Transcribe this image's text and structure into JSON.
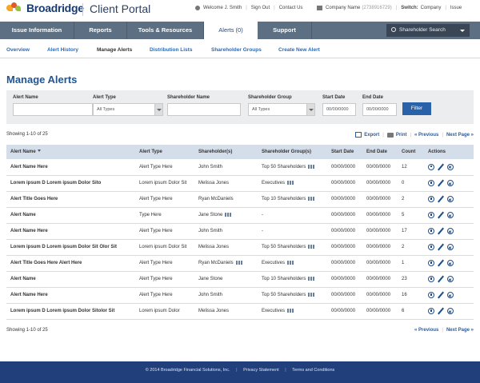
{
  "header": {
    "logo_text": "Broadridge",
    "portal_title": "Client Portal",
    "welcome": "Welcome  J. Smith",
    "sign_out": "Sign Out",
    "contact_us": "Contact Us",
    "company_name": "Company Name",
    "company_id": "(2738916729)",
    "switch_label": "Switch:",
    "switch_company": "Company",
    "switch_issue": "Issue"
  },
  "main_nav": {
    "tabs": [
      "Issue Information",
      "Reports",
      "Tools & Resources",
      "Alerts (0)",
      "Support"
    ],
    "active": "Alerts (0)",
    "search_label": "Shareholder Search"
  },
  "sub_nav": {
    "items": [
      "Overview",
      "Alert History",
      "Manage Alerts",
      "Distribution Lists",
      "Shareholder Groups",
      "Create New Alert"
    ],
    "active": "Manage Alerts"
  },
  "page": {
    "title": "Manage Alerts"
  },
  "filters": {
    "alert_name_label": "Alert Name",
    "alert_type_label": "Alert Type",
    "alert_type_value": "All Types",
    "shareholder_name_label": "Shareholder Name",
    "shareholder_group_label": "Shareholder Group",
    "shareholder_group_value": "All Types",
    "start_date_label": "Start Date",
    "start_date_value": "00/00/0000",
    "end_date_label": "End Date",
    "end_date_value": "00/00/0000",
    "filter_button": "Filter"
  },
  "results": {
    "showing": "Showing 1-10 of 25",
    "export": "Export",
    "print": "Print",
    "previous": "« Previous",
    "next": "Next Page »"
  },
  "table": {
    "columns": [
      "Alert Name",
      "Alert Type",
      "Shareholder(s)",
      "Shareholder Group(s)",
      "Start Date",
      "End Date",
      "Count",
      "Actions"
    ],
    "rows": [
      {
        "name": "Alert Name Here",
        "type": "Alert Type Here",
        "shareholder": "John Smith",
        "sh_icon": false,
        "group": "Top 50 Shareholders",
        "group_icon": true,
        "start": "00/00/0000",
        "end": "00/00/0000",
        "count": "12"
      },
      {
        "name": "Lorem ipsum D Lorem ipsum Dolor Sito",
        "type": "Lorem ipsum Dolor Sit",
        "shareholder": "Melissa Jones",
        "sh_icon": false,
        "group": "Executives",
        "group_icon": true,
        "start": "00/00/0000",
        "end": "00/00/0000",
        "count": "0"
      },
      {
        "name": "Alert Title Goes Here",
        "type": "Alert Type Here",
        "shareholder": "Ryan McDaniels",
        "sh_icon": false,
        "group": "Top 10 Shareholders",
        "group_icon": true,
        "start": "00/00/0000",
        "end": "00/00/0000",
        "count": "2"
      },
      {
        "name": "Alert Name",
        "type": "Type Here",
        "shareholder": "Jane Stone",
        "sh_icon": true,
        "group": "-",
        "group_icon": false,
        "start": "00/00/0000",
        "end": "00/00/0000",
        "count": "5"
      },
      {
        "name": "Alert Name Here",
        "type": "Alert Type Here",
        "shareholder": "John Smith",
        "sh_icon": false,
        "group": "-",
        "group_icon": false,
        "start": "00/00/0000",
        "end": "00/00/0000",
        "count": "17"
      },
      {
        "name": "Lorem ipsum D Lorem ipsum Dolor Sit Olor Sit",
        "type": "Lorem ipsum Dolor Sit",
        "shareholder": "Melissa Jones",
        "sh_icon": false,
        "group": "Top 50 Shareholders",
        "group_icon": true,
        "start": "00/00/0000",
        "end": "00/00/0000",
        "count": "2"
      },
      {
        "name": "Alert Title Goes Here Alert Here",
        "type": "Alert Type Here",
        "shareholder": "Ryan McDaniels",
        "sh_icon": true,
        "group": "Executives",
        "group_icon": true,
        "start": "00/00/0000",
        "end": "00/00/0000",
        "count": "1"
      },
      {
        "name": "Alert Name",
        "type": "Alert Type Here",
        "shareholder": "Jane Stone",
        "sh_icon": false,
        "group": "Top 10 Shareholders",
        "group_icon": true,
        "start": "00/00/0000",
        "end": "00/00/0000",
        "count": "23"
      },
      {
        "name": "Alert Name Here",
        "type": "Alert Type Here",
        "shareholder": "John Smith",
        "sh_icon": false,
        "group": "Top 50 Shareholders",
        "group_icon": true,
        "start": "00/00/0000",
        "end": "00/00/0000",
        "count": "16"
      },
      {
        "name": "Lorem ipsum D Lorem ipsum Dolor Sitolor Sit",
        "type": "Lorem ipsum Dolor",
        "shareholder": "Melissa Jones",
        "sh_icon": false,
        "group": "Executives",
        "group_icon": true,
        "start": "00/00/0000",
        "end": "00/00/0000",
        "count": "6"
      }
    ]
  },
  "footer": {
    "copyright": "© 2014 Broadridge Financial Solutions, Inc.",
    "privacy": "Privacy Statement",
    "terms": "Terms and Conditions"
  },
  "colors": {
    "nav_bg": "#5d6f82",
    "brand_blue": "#1f5594",
    "footer_bg": "#213f7a",
    "button_blue": "#2962a9"
  }
}
